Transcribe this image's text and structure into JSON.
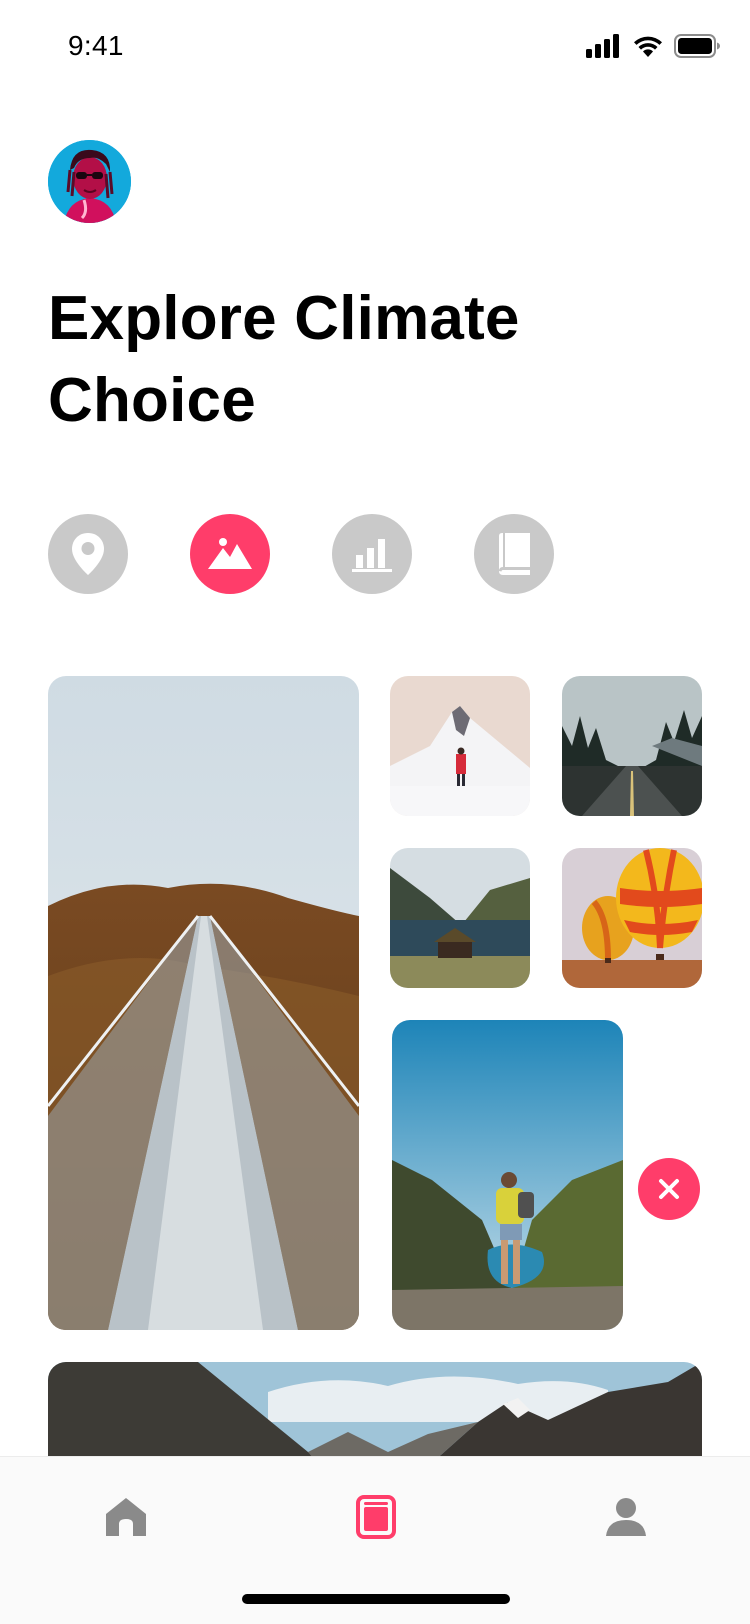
{
  "status_bar": {
    "time": "9:41",
    "icons": [
      "cellular-signal-icon",
      "wifi-icon",
      "battery-icon"
    ]
  },
  "profile": {
    "avatar_icon": "user-avatar"
  },
  "header": {
    "title": "Explore Climate Choice"
  },
  "categories": [
    {
      "icon": "location-pin-icon",
      "active": false
    },
    {
      "icon": "landscape-icon",
      "active": true
    },
    {
      "icon": "bar-chart-icon",
      "active": false
    },
    {
      "icon": "book-icon",
      "active": false
    }
  ],
  "gallery": {
    "photos": [
      "suspension-bridge",
      "snowy-mountain-hiker",
      "forest-road",
      "lake-cabin",
      "hot-air-balloons",
      "hiker-fjord-view",
      "mountain-panorama"
    ],
    "remove_icon": "close-icon"
  },
  "tab_bar": {
    "tabs": [
      {
        "icon": "home-icon",
        "active": false
      },
      {
        "icon": "gallery-icon",
        "active": true
      },
      {
        "icon": "profile-icon",
        "active": false
      }
    ]
  },
  "colors": {
    "accent": "#ff3d6a",
    "inactive": "#c9c9c9",
    "icon_gray": "#8a8a8a"
  }
}
